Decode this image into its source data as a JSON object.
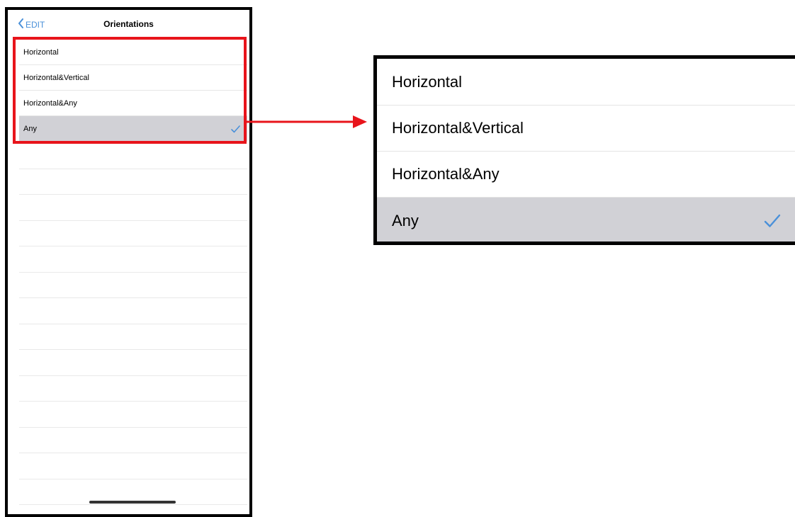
{
  "nav": {
    "back_label": "EDIT",
    "title": "Orientations"
  },
  "options": [
    {
      "label": "Horizontal",
      "selected": false
    },
    {
      "label": "Horizontal&Vertical",
      "selected": false
    },
    {
      "label": "Horizontal&Any",
      "selected": false
    },
    {
      "label": "Any",
      "selected": true
    }
  ],
  "colors": {
    "accent": "#4a90d9",
    "highlight": "#e8141b",
    "selected_row": "#d1d1d6"
  }
}
